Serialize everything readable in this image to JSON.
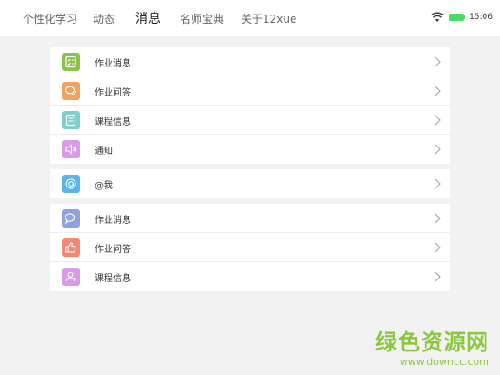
{
  "tabs": [
    {
      "label": "个性化学习"
    },
    {
      "label": "动态"
    },
    {
      "label": "消息"
    },
    {
      "label": "名师宝典"
    },
    {
      "label": "关于12xue"
    }
  ],
  "status": {
    "time": "15:06",
    "battery_color": "#4cd964"
  },
  "group1": [
    {
      "label": "作业消息",
      "icon": "checklist-icon",
      "color": "#8bc34a"
    },
    {
      "label": "作业问答",
      "icon": "chat-bubble-icon",
      "color": "#f4a261"
    },
    {
      "label": "课程信息",
      "icon": "notebook-icon",
      "color": "#7ecfc8"
    },
    {
      "label": "通知",
      "icon": "speaker-icon",
      "color": "#d99be8"
    }
  ],
  "group2": [
    {
      "label": "@我",
      "icon": "at-sign-icon",
      "color": "#5ab4e8"
    }
  ],
  "group3": [
    {
      "label": "作业消息",
      "icon": "speech-bubble-icon",
      "color": "#8ea4d9"
    },
    {
      "label": "作业问答",
      "icon": "thumbs-up-icon",
      "color": "#f08a73"
    },
    {
      "label": "课程信息",
      "icon": "user-icon",
      "color": "#d99be8"
    }
  ],
  "watermark": {
    "main": "绿色资源网",
    "sub": "www.downcc.com"
  }
}
